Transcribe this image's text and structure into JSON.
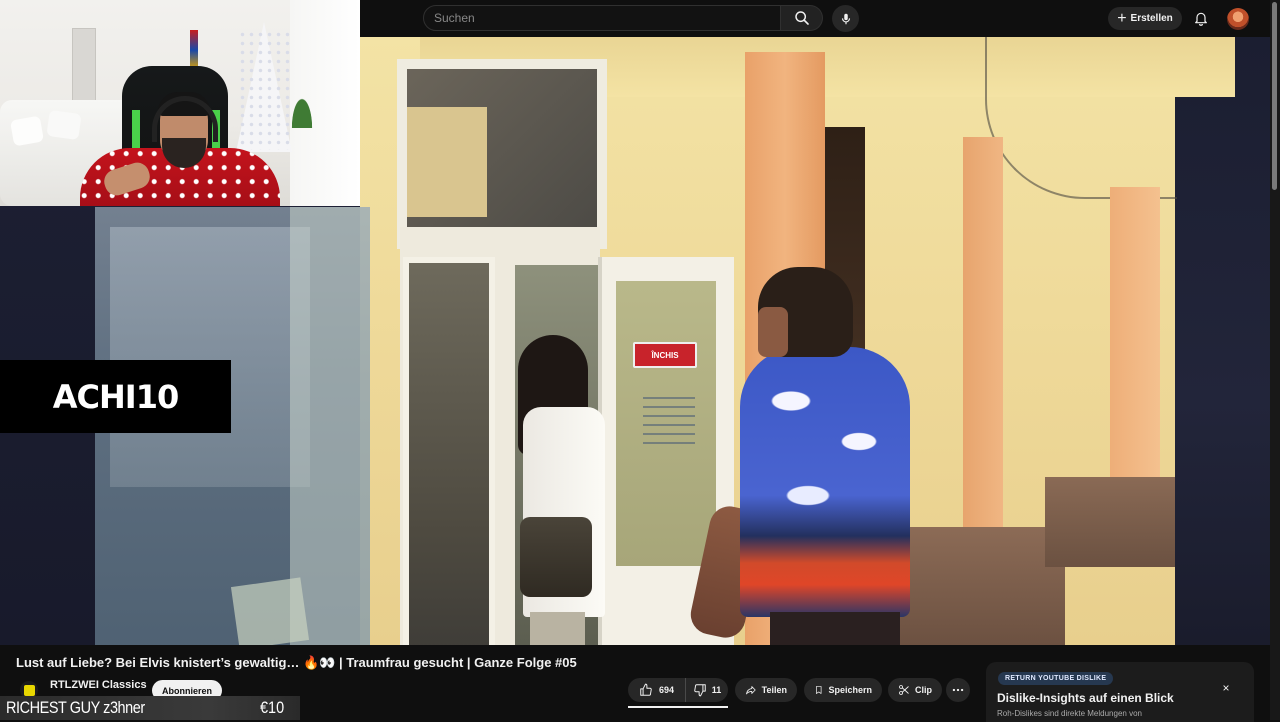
{
  "topbar": {
    "search_placeholder": "Suchen",
    "create_label": "Erstellen"
  },
  "video": {
    "overlay_logo": "ACHI10",
    "sign_text": "ÎNCHIS",
    "title": "Lust auf Liebe? Bei Elvis knistert’s gewaltig… 🔥👀 | Traumfrau gesucht | Ganze Folge #05"
  },
  "channel": {
    "name": "RTLZWEI Classics",
    "subscribe_label": "Abonnieren"
  },
  "actions": {
    "like_count": "694",
    "dislike_count": "11",
    "share_label": "Teilen",
    "save_label": "Speichern",
    "clip_label": "Clip"
  },
  "ryd": {
    "tag": "RETURN YOUTUBE DISLIKE",
    "title": "Dislike-Insights auf einen Blick",
    "subtitle": "Roh-Dislikes sind direkte Meldungen von",
    "close": "×"
  },
  "stream_overlay": {
    "left_text": "RICHEST GUY z3hner",
    "right_text": "€10"
  },
  "colors": {
    "background": "#0f0f0f",
    "pill": "#272727",
    "ryd_tag": "#263850",
    "logo_bg": "#000000"
  },
  "icons": {
    "search": "search-icon",
    "mic": "mic-icon",
    "create": "plus-icon",
    "bell": "bell-icon",
    "like": "thumbs-up-icon",
    "dislike": "thumbs-down-icon",
    "share": "share-icon",
    "save": "bookmark-icon",
    "clip": "scissors-icon",
    "more": "more-horizontal-icon"
  }
}
